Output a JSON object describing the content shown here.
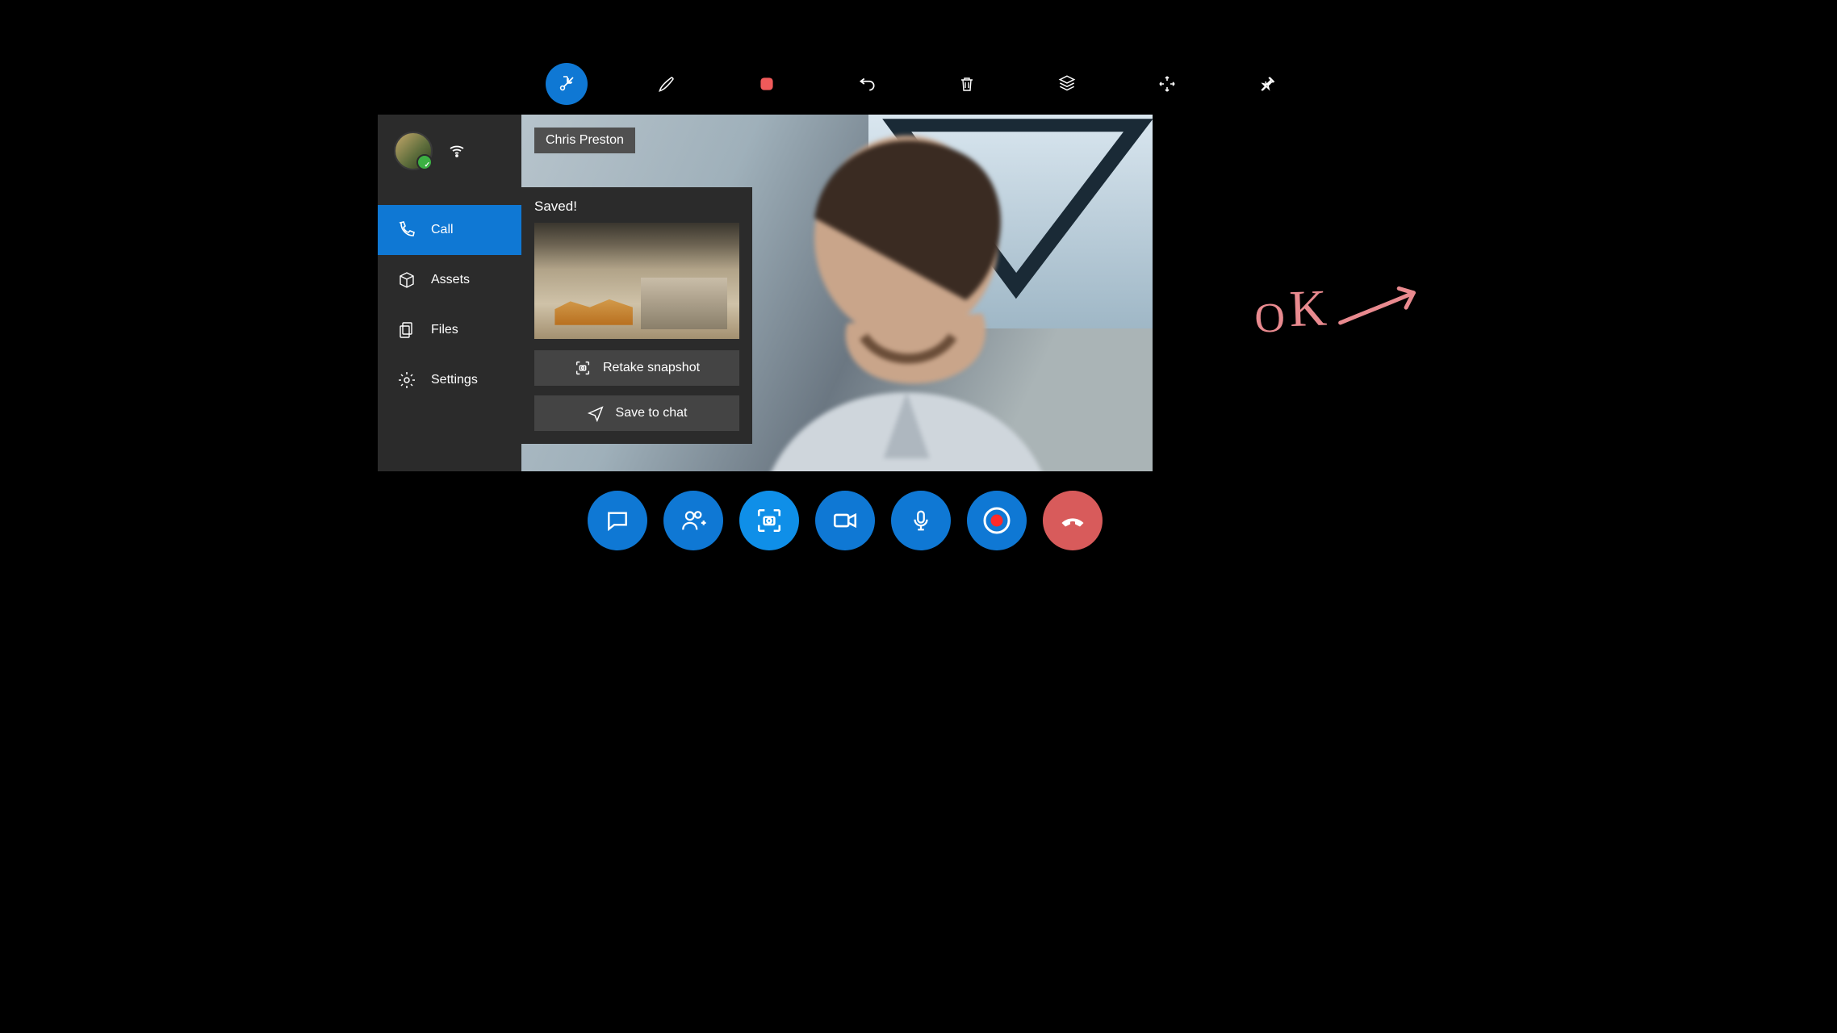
{
  "toolbar": {
    "items": [
      "minimize",
      "pen",
      "stop-record",
      "undo",
      "delete",
      "layers",
      "expand",
      "pin"
    ],
    "stop_color": "#f05a5a"
  },
  "sidebar": {
    "items": [
      {
        "label": "Call",
        "icon": "phone-icon",
        "active": true
      },
      {
        "label": "Assets",
        "icon": "box-icon",
        "active": false
      },
      {
        "label": "Files",
        "icon": "files-icon",
        "active": false
      }
    ],
    "settings_label": "Settings"
  },
  "video": {
    "participant_name": "Chris Preston"
  },
  "popover": {
    "title": "Saved!",
    "retake_label": "Retake snapshot",
    "save_label": "Save to chat"
  },
  "callbar": {
    "buttons": [
      "chat",
      "add-participant",
      "snapshot",
      "video",
      "mic",
      "record",
      "hangup"
    ]
  },
  "annotation": {
    "text_o": "O",
    "text_k": "K",
    "color": "#e98a8f"
  }
}
